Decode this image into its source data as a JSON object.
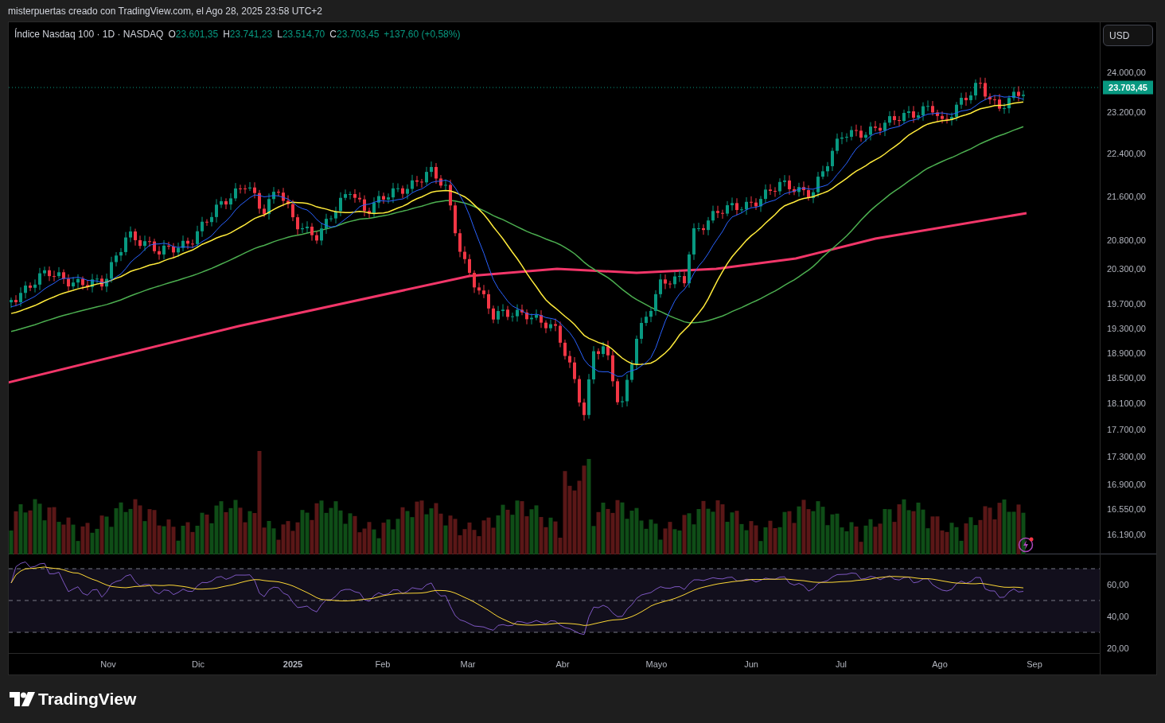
{
  "caption": "misterpuertas creado con TradingView.com, el Ago 28, 2025 23:58 UTC+2",
  "legend": {
    "symbol": "Índice Nasdaq 100 · 1D · NASDAQ",
    "values": [
      {
        "label": "O",
        "value": "23.601,35"
      },
      {
        "label": "H",
        "value": "23.741,23"
      },
      {
        "label": "L",
        "value": "23.514,70"
      },
      {
        "label": "C",
        "value": "23.703,45"
      }
    ],
    "change": "+137,60 (+0,58%)"
  },
  "currency_button": "USD",
  "price_axis": {
    "labels": [
      "24.000,00",
      "23.200,00",
      "22.400,00",
      "21.600,00",
      "20.800,00",
      "20.300,00",
      "19.700,00",
      "19.300,00",
      "18.900,00",
      "18.500,00",
      "18.100,00",
      "17.700,00",
      "17.300,00",
      "16.900,00",
      "16.550,00",
      "16.190,00"
    ],
    "last_price": "23.703,45"
  },
  "rsi_axis": {
    "labels": [
      "60,00",
      "40,00",
      "20,00"
    ]
  },
  "time_axis": {
    "labels": [
      "Nov",
      "Dic",
      "2025",
      "Feb",
      "Mar",
      "Abr",
      "Mayo",
      "Jun",
      "Jul",
      "Ago",
      "Sep"
    ]
  },
  "footer": {
    "logo_text": "TradingView"
  }
}
